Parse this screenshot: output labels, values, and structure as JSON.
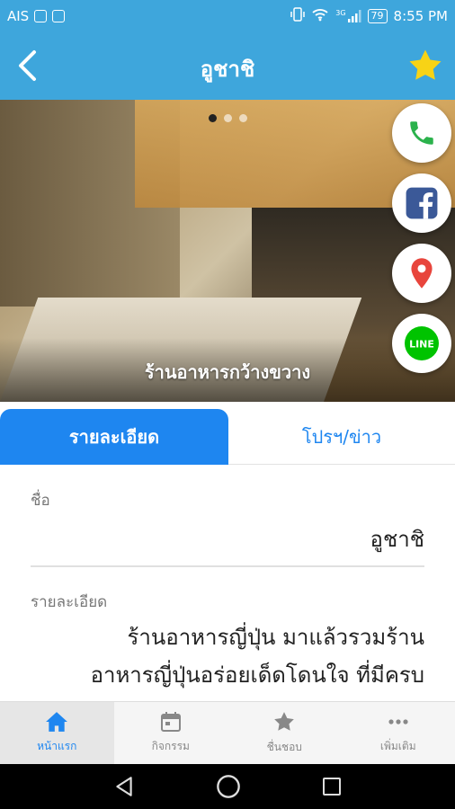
{
  "status_bar": {
    "carrier": "AIS",
    "network": "3G",
    "battery": "79",
    "time": "8:55 PM"
  },
  "app_bar": {
    "title": "อูชาชิ"
  },
  "hero": {
    "caption": "ร้านอาหารกว้างขวาง",
    "slide_count": 3,
    "active_slide": 1
  },
  "actions": [
    {
      "icon": "phone-icon",
      "color": "#2bb24c"
    },
    {
      "icon": "facebook-icon",
      "color": "#3b5998"
    },
    {
      "icon": "map-pin-icon",
      "color": "#e8453c"
    },
    {
      "icon": "line-icon",
      "color": "#00c300",
      "label": "LINE"
    }
  ],
  "tabs": {
    "details": "รายละเอียด",
    "promo": "โปรฯ/ข่าว"
  },
  "content": {
    "name_label": "ชื่อ",
    "name_value": "อูชาชิ",
    "desc_label": "รายละเอียด",
    "desc_line1": "ร้านอาหารญี่ปุ่น มาแล้วรวมร้าน",
    "desc_line2": "อาหารญี่ปุ่นอร่อยเด็ดโดนใจ ที่มีครบ"
  },
  "bottom_nav": [
    {
      "icon": "home-icon",
      "label": "หน้าแรก",
      "active": true
    },
    {
      "icon": "calendar-icon",
      "label": "กิจกรรม",
      "active": false
    },
    {
      "icon": "star-icon",
      "label": "ชื่นชอบ",
      "active": false
    },
    {
      "icon": "more-icon",
      "label": "เพิ่มเติม",
      "active": false
    }
  ],
  "colors": {
    "primary": "#3ea6dc",
    "accent": "#1e86f0",
    "star": "#f7d316"
  }
}
